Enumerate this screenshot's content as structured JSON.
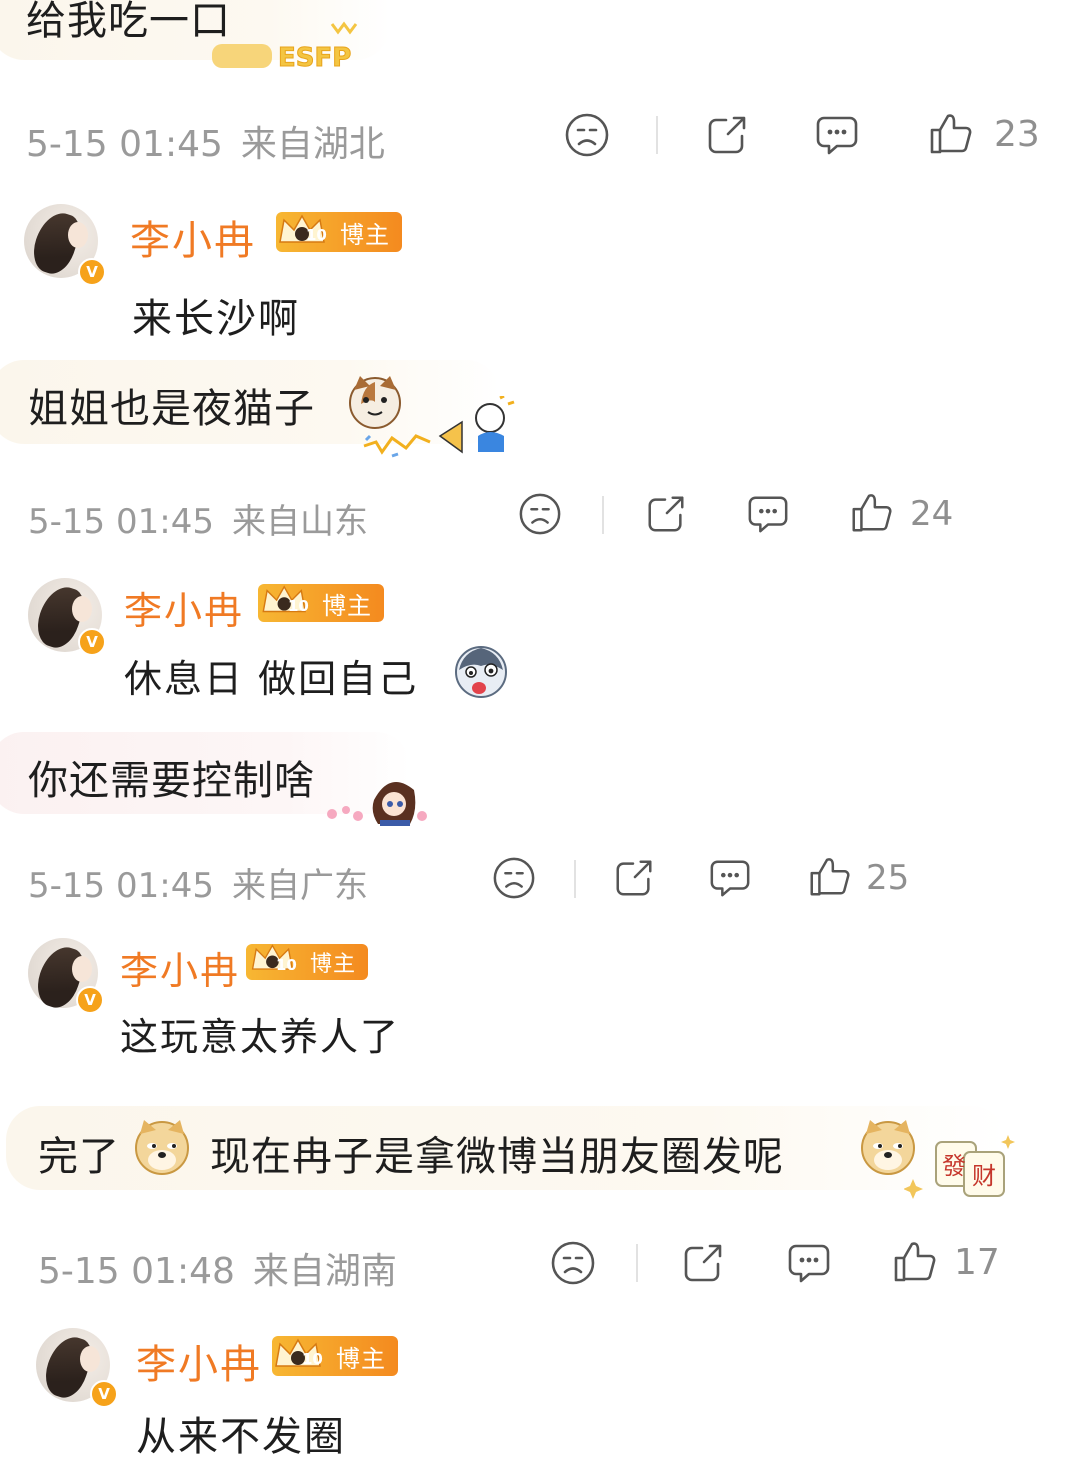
{
  "colors": {
    "username": "#f07a24",
    "meta_text": "#9a9a9a",
    "badge_gradient_start": "#f7b733",
    "badge_gradient_end": "#f48a1f"
  },
  "top_comment": {
    "text": "给我吃一口",
    "decoration_text": "ESFP",
    "meta": {
      "time": "5-15 01:45",
      "location": "来自湖北",
      "likes": "23"
    }
  },
  "threads": [
    {
      "reply": {
        "name": "李小冉",
        "badge_level": "10",
        "badge_label": "博主",
        "verified": "V",
        "text": "来长沙啊"
      },
      "comment": {
        "text": "姐姐也是夜猫子",
        "emoji": "cat-emoji"
      },
      "meta": {
        "time": "5-15 01:45",
        "location": "来自山东",
        "likes": "24"
      }
    },
    {
      "reply": {
        "name": "李小冉",
        "badge_level": "10",
        "badge_label": "博主",
        "verified": "V",
        "text": "休息日 做回自己",
        "emoji": "husky-emoji"
      },
      "comment": {
        "text": "你还需要控制啥"
      },
      "meta": {
        "time": "5-15 01:45",
        "location": "来自广东",
        "likes": "25"
      }
    },
    {
      "reply": {
        "name": "李小冉",
        "badge_level": "10",
        "badge_label": "博主",
        "verified": "V",
        "text": "这玩意太养人了"
      },
      "comment": {
        "text_a": "完了",
        "text_b": "现在冉子是拿微博当朋友圈发呢",
        "sticker_chars": [
          "發",
          "财"
        ]
      },
      "meta": {
        "time": "5-15 01:48",
        "location": "来自湖南",
        "likes": "17"
      }
    }
  ],
  "final_reply": {
    "name": "李小冉",
    "badge_level": "10",
    "badge_label": "博主",
    "verified": "V",
    "text": "从来不发圈"
  },
  "actions": [
    "dislike-icon",
    "share-icon",
    "comment-icon",
    "like-icon"
  ]
}
